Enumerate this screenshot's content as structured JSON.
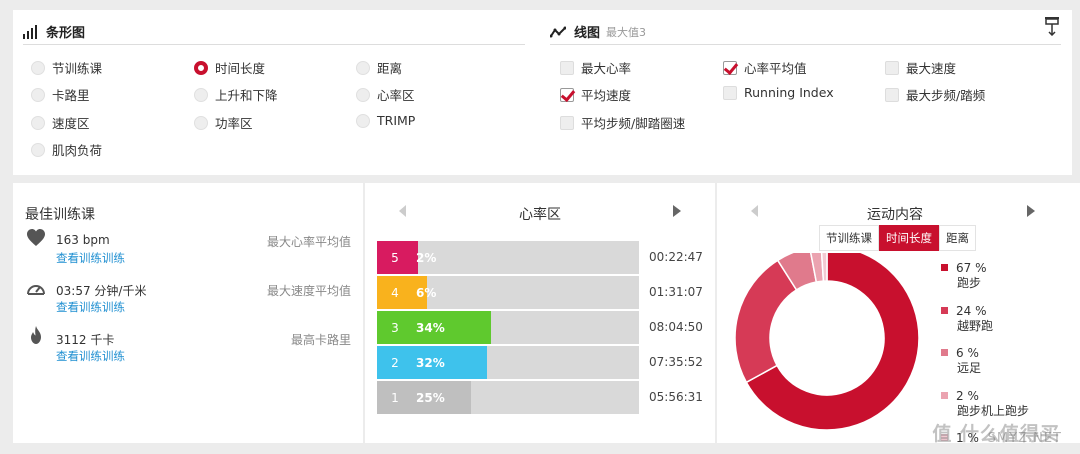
{
  "filters": {
    "bar": {
      "title": "条形图",
      "options": [
        {
          "label": "节训练课",
          "selected": false
        },
        {
          "label": "时间长度",
          "selected": true
        },
        {
          "label": "距离",
          "selected": false
        },
        {
          "label": "卡路里",
          "selected": false
        },
        {
          "label": "上升和下降",
          "selected": false
        },
        {
          "label": "心率区",
          "selected": false
        },
        {
          "label": "速度区",
          "selected": false
        },
        {
          "label": "功率区",
          "selected": false
        },
        {
          "label": "TRIMP",
          "selected": false
        },
        {
          "label": "肌肉负荷",
          "selected": false
        }
      ]
    },
    "line": {
      "title": "线图",
      "subtitle": "最大值3",
      "options": [
        {
          "label": "最大心率",
          "checked": false
        },
        {
          "label": "心率平均值",
          "checked": true
        },
        {
          "label": "最大速度",
          "checked": false
        },
        {
          "label": "平均速度",
          "checked": true
        },
        {
          "label": "Running Index",
          "checked": false
        },
        {
          "label": "最大步频/踏频",
          "checked": false
        },
        {
          "label": "平均步频/脚踏圈速",
          "checked": false
        }
      ]
    }
  },
  "best": {
    "title": "最佳训练课",
    "stats": [
      {
        "value": "163 bpm",
        "link": "查看训练训练",
        "label": "最大心率平均值",
        "icon": "heart-icon"
      },
      {
        "value": "03:57 分钟/千米",
        "link": "查看训练训练",
        "label": "最大速度平均值",
        "icon": "speedometer-icon"
      },
      {
        "value": "3112 千卡",
        "link": "查看训练训练",
        "label": "最高卡路里",
        "icon": "flame-icon"
      }
    ]
  },
  "hr_zones": {
    "title": "心率区",
    "rows": [
      {
        "zone": "5",
        "percent": "2%",
        "value": 2,
        "time": "00:22:47",
        "color": "#d81b60"
      },
      {
        "zone": "4",
        "percent": "6%",
        "value": 6,
        "time": "01:31:07",
        "color": "#f9b21d"
      },
      {
        "zone": "3",
        "percent": "34%",
        "value": 34,
        "time": "08:04:50",
        "color": "#5fc92e"
      },
      {
        "zone": "2",
        "percent": "32%",
        "value": 32,
        "time": "07:35:52",
        "color": "#3ec2ec"
      },
      {
        "zone": "1",
        "percent": "25%",
        "value": 25,
        "time": "05:56:31",
        "color": "#bfbfbf"
      }
    ]
  },
  "content": {
    "title": "运动内容",
    "tabs": [
      {
        "label": "节训练课",
        "active": false
      },
      {
        "label": "时间长度",
        "active": true
      },
      {
        "label": "距离",
        "active": false
      }
    ],
    "legend": [
      {
        "percent": "67 %",
        "name": "跑步",
        "value": 67,
        "color": "#c8102e"
      },
      {
        "percent": "24 %",
        "name": "越野跑",
        "value": 24,
        "color": "#d63a56"
      },
      {
        "percent": "6 %",
        "name": "远足",
        "value": 6,
        "color": "#e07a8c"
      },
      {
        "percent": "2 %",
        "name": "跑步机上跑步",
        "value": 2,
        "color": "#eba3b0"
      },
      {
        "percent": "1 %",
        "name": "",
        "value": 1,
        "color": "#f3c9d1"
      }
    ]
  },
  "watermark": {
    "line1": "值 什么值得买",
    "line2": "SMYZ.NET"
  }
}
